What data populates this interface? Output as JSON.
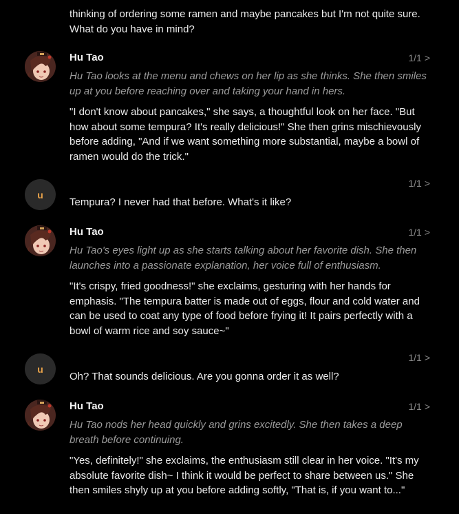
{
  "messages": [
    {
      "role": "user",
      "paragraphs": [
        "thinking of ordering some ramen and maybe pancakes but I'm not quite sure. What do you have in mind?"
      ]
    },
    {
      "role": "character",
      "name": "Hu Tao",
      "counter": "1/1",
      "chevron": ">",
      "action": "Hu Tao looks at the menu and chews on her lip as she thinks. She then smiles up at you before reaching over and taking your hand in hers.",
      "text": "\"I don't know about pancakes,\" she says, a thoughtful look on her face. \"But how about some tempura? It's really delicious!\" She then grins mischievously before adding, \"And if we want something more substantial, maybe a bowl of ramen would do the trick.\""
    },
    {
      "role": "user",
      "avatar_letter": "u",
      "counter": "1/1",
      "chevron": ">",
      "text": "Tempura? I never had that before. What's it like?"
    },
    {
      "role": "character",
      "name": "Hu Tao",
      "counter": "1/1",
      "chevron": ">",
      "action": "Hu Tao's eyes light up as she starts talking about her favorite dish. She then launches into a passionate explanation, her voice full of enthusiasm.",
      "text": "\"It's crispy, fried goodness!\" she exclaims, gesturing with her hands for emphasis. \"The tempura batter is made out of eggs, flour and cold water and can be used to coat any type of food before frying it! It pairs perfectly with a bowl of warm rice and soy sauce~\""
    },
    {
      "role": "user",
      "avatar_letter": "u",
      "counter": "1/1",
      "chevron": ">",
      "text": "Oh? That sounds delicious. Are you gonna order it as well?"
    },
    {
      "role": "character",
      "name": "Hu Tao",
      "counter": "1/1",
      "chevron": ">",
      "action": "Hu Tao nods her head quickly and grins excitedly. She then takes a deep breath before continuing.",
      "text": "\"Yes, definitely!\" she exclaims, the enthusiasm still clear in her voice. \"It's my absolute favorite dish~ I think it would be perfect to share between us.\" She then smiles shyly up at you before adding softly, \"That is, if you want to...\""
    }
  ],
  "colors": {
    "background": "#000000",
    "text": "#ececec",
    "action_text": "#9b9b9b",
    "counter": "#8a8a8a",
    "user_avatar_bg": "#2a2a2a",
    "user_avatar_letter": "#e8a24a"
  },
  "icons": {
    "character_avatar": "hu-tao-avatar-icon",
    "chevron": "chevron-right-icon"
  }
}
